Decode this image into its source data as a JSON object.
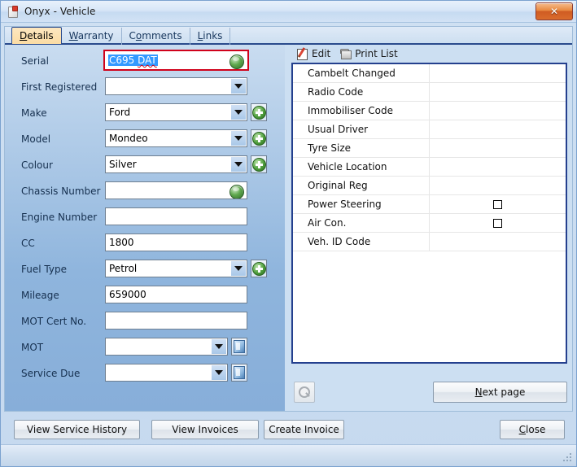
{
  "window": {
    "title": "Onyx - Vehicle",
    "icon": "document-icon",
    "close_label": "✕"
  },
  "tabs": [
    {
      "name": "details",
      "pre": "",
      "accel": "D",
      "post": "etails",
      "active": true
    },
    {
      "name": "warranty",
      "pre": "",
      "accel": "W",
      "post": "arranty",
      "active": false
    },
    {
      "name": "comments",
      "pre": "C",
      "accel": "o",
      "post": "mments",
      "active": false
    },
    {
      "name": "links",
      "pre": "",
      "accel": "L",
      "post": "inks",
      "active": false
    }
  ],
  "form": {
    "serial": {
      "label": "Serial",
      "value_selected": "C695 ",
      "value_misspelled": "DAT",
      "icon": "globe-icon",
      "validation_color": "#d0021b"
    },
    "first_registered": {
      "label": "First Registered",
      "value": "",
      "type": "combo"
    },
    "make": {
      "label": "Make",
      "value": "Ford",
      "type": "combo-plus"
    },
    "model": {
      "label": "Model",
      "value": "Mondeo",
      "type": "combo-plus"
    },
    "colour": {
      "label": "Colour",
      "value": "Silver",
      "type": "combo-plus"
    },
    "chassis_number": {
      "label": "Chassis Number",
      "value": "",
      "type": "text-globe"
    },
    "engine_number": {
      "label": "Engine Number",
      "value": "",
      "type": "text"
    },
    "cc": {
      "label": "CC",
      "value": "1800",
      "type": "text"
    },
    "fuel_type": {
      "label": "Fuel Type",
      "value": "Petrol",
      "type": "combo-plus"
    },
    "mileage": {
      "label": "Mileage",
      "value": "659000",
      "type": "text"
    },
    "mot_cert_no": {
      "label": "MOT Cert No.",
      "value": "",
      "type": "text"
    },
    "mot": {
      "label": "MOT",
      "value": "",
      "type": "combo-calendar"
    },
    "service_due": {
      "label": "Service Due",
      "value": "",
      "type": "combo-calendar"
    }
  },
  "list_toolbar": {
    "edit_label": "Edit",
    "edit_icon": "edit-pencil-icon",
    "print_label": "Print List",
    "print_icon": "printer-icon"
  },
  "list_rows": [
    {
      "name": "Cambelt Changed",
      "value": "",
      "checkbox": false,
      "checked": false
    },
    {
      "name": "Radio Code",
      "value": "",
      "checkbox": false,
      "checked": false
    },
    {
      "name": "Immobiliser Code",
      "value": "",
      "checkbox": false,
      "checked": false
    },
    {
      "name": "Usual Driver",
      "value": "",
      "checkbox": false,
      "checked": false
    },
    {
      "name": "Tyre Size",
      "value": "",
      "checkbox": false,
      "checked": false
    },
    {
      "name": "Vehicle Location",
      "value": "",
      "checkbox": false,
      "checked": false
    },
    {
      "name": "Original Reg",
      "value": "",
      "checkbox": false,
      "checked": false
    },
    {
      "name": "Power Steering",
      "value": "",
      "checkbox": true,
      "checked": false
    },
    {
      "name": "Air Con.",
      "value": "",
      "checkbox": true,
      "checked": false
    },
    {
      "name": "Veh. ID Code",
      "value": "",
      "checkbox": false,
      "checked": false
    }
  ],
  "actions": {
    "search_icon": "magnifier-icon",
    "next_page_pre": "",
    "next_page_accel": "N",
    "next_page_post": "ext page",
    "view_service_history": "View Service History",
    "view_invoices": "View Invoices",
    "create_invoice": "Create Invoice",
    "close_pre": "",
    "close_accel": "C",
    "close_post": "lose"
  },
  "colors": {
    "form_background": "#8fb5dd",
    "tab_active": "#fbdca4",
    "tab_border": "#2a4b8d",
    "list_border": "#24408e",
    "validation": "#d0021b",
    "selection": "#3399ff"
  }
}
